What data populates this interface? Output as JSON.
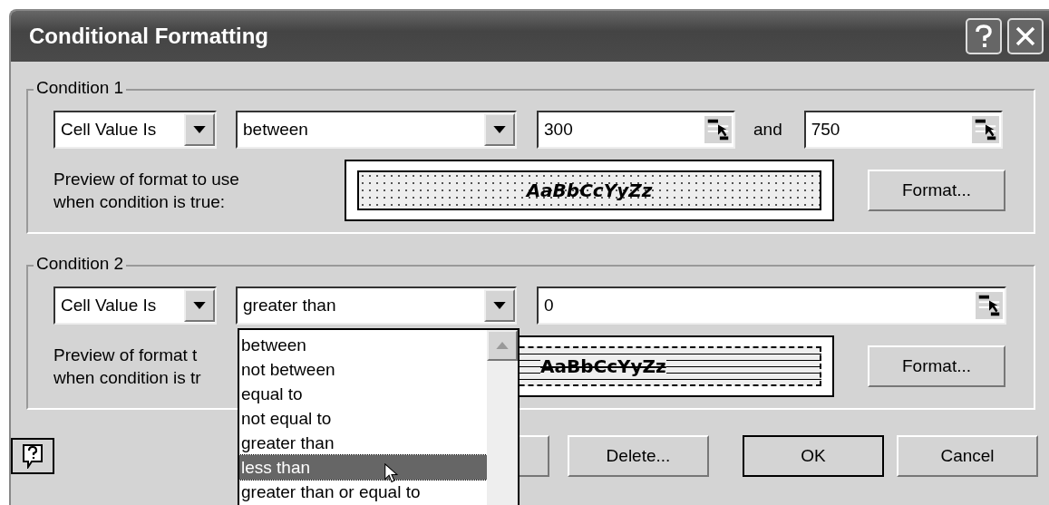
{
  "window": {
    "title": "Conditional Formatting"
  },
  "conditions": [
    {
      "legend": "Condition 1",
      "source": "Cell Value Is",
      "operator": "between",
      "values": [
        "300",
        "750"
      ],
      "joiner": "and",
      "preview_label": [
        "Preview of format to use",
        "when condition is true:"
      ],
      "preview": {
        "text": "AaBbCcYyZz",
        "italic": true,
        "strikethrough": false,
        "kind": "dots"
      },
      "format_button": "Format..."
    },
    {
      "legend": "Condition 2",
      "source": "Cell Value Is",
      "operator": "greater than",
      "values": [
        "0"
      ],
      "preview_label": [
        "Preview of format t",
        "when condition is tr"
      ],
      "preview": {
        "text": "AaBbCcYyZz",
        "italic": false,
        "strikethrough": true,
        "kind": "lines"
      },
      "format_button": "Format..."
    }
  ],
  "dropdown": {
    "items": [
      {
        "label": "between",
        "selected": false
      },
      {
        "label": "not between",
        "selected": false
      },
      {
        "label": "equal to",
        "selected": false
      },
      {
        "label": "not equal to",
        "selected": false
      },
      {
        "label": "greater than",
        "selected": false
      },
      {
        "label": "less than",
        "selected": true
      },
      {
        "label": "greater than or equal to",
        "selected": false
      }
    ]
  },
  "buttons": [
    {
      "kind": "covered"
    },
    {
      "kind": "text",
      "label": "Delete...",
      "default": false
    },
    {
      "kind": "text",
      "label": "OK",
      "default": true
    },
    {
      "kind": "text",
      "label": "Cancel",
      "default": false
    }
  ]
}
